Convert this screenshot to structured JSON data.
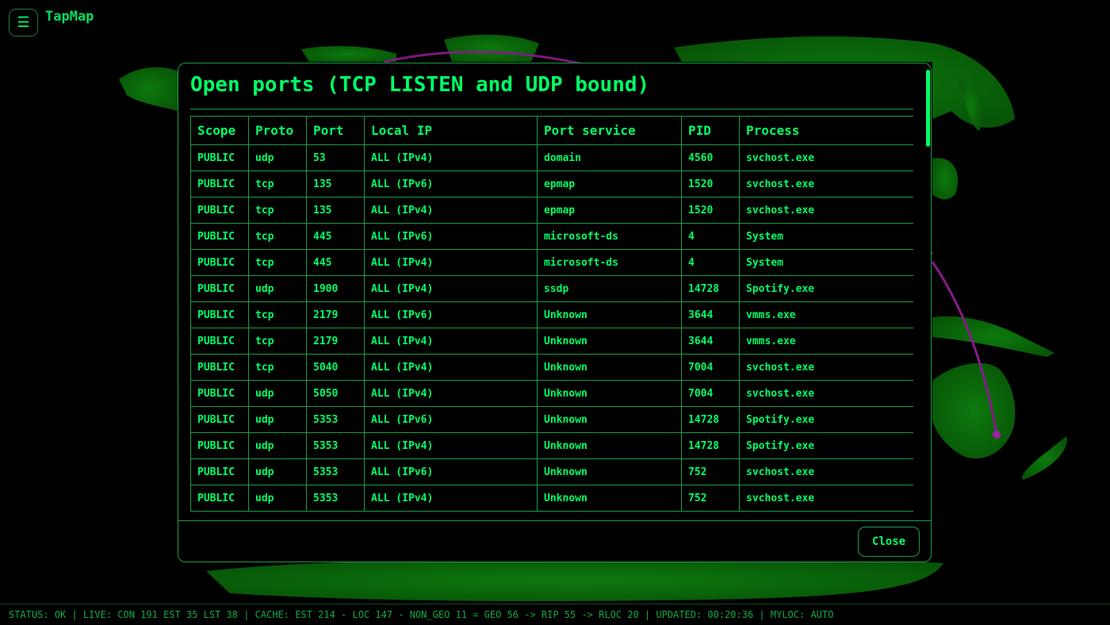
{
  "app": {
    "title": "TapMap",
    "menu_icon": "☰"
  },
  "colors": {
    "accent": "#00ff66",
    "land": "#0a6a0a",
    "route": "#8a1a8a",
    "border": "#1d9a48"
  },
  "modal": {
    "title": "Open ports (TCP LISTEN and UDP bound)",
    "columns": [
      "Scope",
      "Proto",
      "Port",
      "Local IP",
      "Port service",
      "PID",
      "Process"
    ],
    "rows": [
      [
        "PUBLIC",
        "udp",
        "53",
        "ALL (IPv4)",
        "domain",
        "4560",
        "svchost.exe"
      ],
      [
        "PUBLIC",
        "tcp",
        "135",
        "ALL (IPv6)",
        "epmap",
        "1520",
        "svchost.exe"
      ],
      [
        "PUBLIC",
        "tcp",
        "135",
        "ALL (IPv4)",
        "epmap",
        "1520",
        "svchost.exe"
      ],
      [
        "PUBLIC",
        "tcp",
        "445",
        "ALL (IPv6)",
        "microsoft-ds",
        "4",
        "System"
      ],
      [
        "PUBLIC",
        "tcp",
        "445",
        "ALL (IPv4)",
        "microsoft-ds",
        "4",
        "System"
      ],
      [
        "PUBLIC",
        "udp",
        "1900",
        "ALL (IPv4)",
        "ssdp",
        "14728",
        "Spotify.exe"
      ],
      [
        "PUBLIC",
        "tcp",
        "2179",
        "ALL (IPv6)",
        "Unknown",
        "3644",
        "vmms.exe"
      ],
      [
        "PUBLIC",
        "tcp",
        "2179",
        "ALL (IPv4)",
        "Unknown",
        "3644",
        "vmms.exe"
      ],
      [
        "PUBLIC",
        "tcp",
        "5040",
        "ALL (IPv4)",
        "Unknown",
        "7004",
        "svchost.exe"
      ],
      [
        "PUBLIC",
        "udp",
        "5050",
        "ALL (IPv4)",
        "Unknown",
        "7004",
        "svchost.exe"
      ],
      [
        "PUBLIC",
        "udp",
        "5353",
        "ALL (IPv6)",
        "Unknown",
        "14728",
        "Spotify.exe"
      ],
      [
        "PUBLIC",
        "udp",
        "5353",
        "ALL (IPv4)",
        "Unknown",
        "14728",
        "Spotify.exe"
      ],
      [
        "PUBLIC",
        "udp",
        "5353",
        "ALL (IPv6)",
        "Unknown",
        "752",
        "svchost.exe"
      ],
      [
        "PUBLIC",
        "udp",
        "5353",
        "ALL (IPv4)",
        "Unknown",
        "752",
        "svchost.exe"
      ]
    ],
    "close_label": "Close"
  },
  "status_bar": {
    "text": "STATUS: OK | LIVE: CON 191 EST 35 LST 38 | CACHE: EST 214 - LOC 147 - NON_GEO 11 = GEO 56 -> RIP 55 -> RLOC 20 | UPDATED: 00:20:36 | MYLOC: AUTO"
  }
}
